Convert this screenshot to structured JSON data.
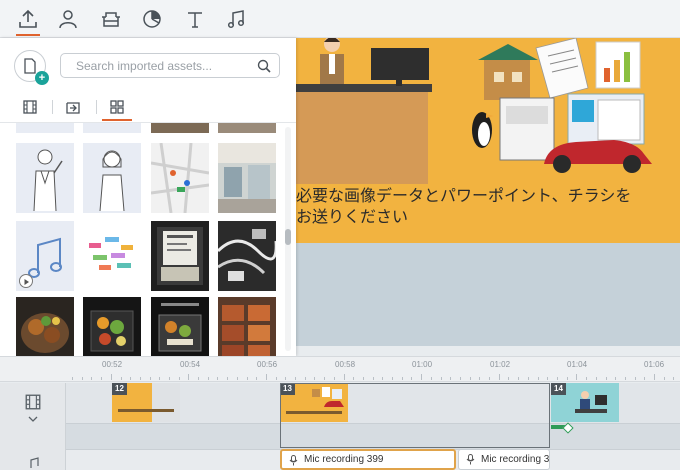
{
  "top_tabs": [
    {
      "icon": "upload-icon",
      "active": true
    },
    {
      "icon": "character-icon",
      "active": false
    },
    {
      "icon": "furniture-icon",
      "active": false
    },
    {
      "icon": "chart-icon",
      "active": false
    },
    {
      "icon": "text-icon",
      "active": false
    },
    {
      "icon": "music-icon",
      "active": false
    }
  ],
  "panel": {
    "search_placeholder": "Search imported assets...",
    "subtabs": [
      {
        "icon": "film-icon",
        "active": false
      },
      {
        "icon": "import-folder-icon",
        "active": false
      },
      {
        "icon": "grid-icon",
        "active": true
      }
    ]
  },
  "slide": {
    "caption_line1": "必要な画像データとパワーポイント、チラシを",
    "caption_line2": "お送りください"
  },
  "ruler": {
    "labels": [
      "00:52",
      "00:54",
      "00:56",
      "00:58",
      "01:00",
      "01:02",
      "01:04",
      "01:06"
    ]
  },
  "clips": [
    {
      "number": "12"
    },
    {
      "number": "13"
    },
    {
      "number": "14"
    }
  ],
  "audio": [
    {
      "label": "Mic recording 399"
    },
    {
      "label": "Mic recording 3"
    }
  ],
  "colors": {
    "accent": "#e0632e",
    "slide_bg": "#f2b340",
    "teal": "#1aa39a",
    "audio_selected": "#e0a34a"
  }
}
